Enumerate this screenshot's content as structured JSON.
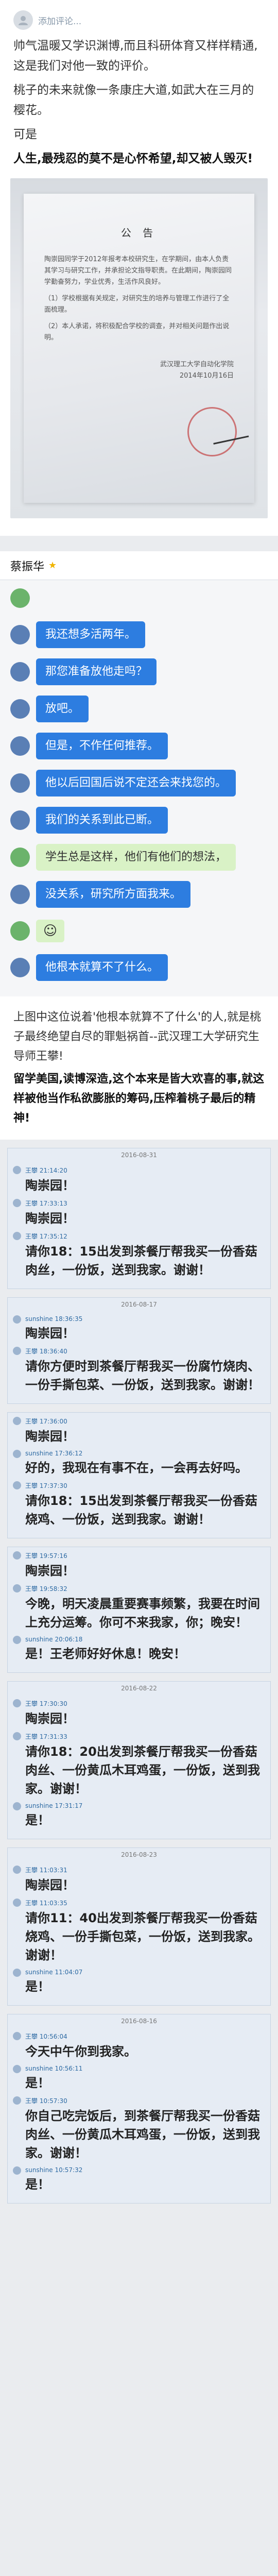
{
  "post": {
    "author_name": "添加评论...",
    "paragraphs": [
      "帅气温暖又学识渊博,而且科研体育又样样精通,这是我们对他一致的评价。",
      "桃子的未来就像一条康庄大道,如武大在三月的樱花。",
      "可是"
    ],
    "bold_paragraph": "人生,最残忍的莫不是心怀希望,却又被人毁灭!"
  },
  "notice": {
    "title": "公 告",
    "body": [
      "陶崇园同学于2012年报考本校研究生，在学期间，由本人负责其学习与研究工作，并承担论文指导职责。在此期间，陶崇园同学勤奋努力，学业优秀，生活作风良好。",
      "（1）学校根据有关规定，对研究生的培养与管理工作进行了全面梳理。",
      "（2）本人承诺，将积极配合学校的调查，并对相关问题作出说明。"
    ],
    "sign_lines": [
      "武汉理工大学自动化学院",
      "2014年10月16日"
    ]
  },
  "chat": {
    "contact_name": "蔡振华",
    "messages": [
      {
        "side": "green",
        "text": ""
      },
      {
        "side": "blue",
        "text": "我还想多活两年。"
      },
      {
        "side": "blue",
        "text": "那您准备放他走吗？"
      },
      {
        "side": "blue",
        "text": "放吧。"
      },
      {
        "side": "blue",
        "text": "但是，不作任何推荐。"
      },
      {
        "side": "blue",
        "text": "他以后回国后说不定还会来找您的。"
      },
      {
        "side": "blue",
        "text": "我们的关系到此已断。"
      },
      {
        "side": "green",
        "text": "学生总是这样，他们有他们的想法，"
      },
      {
        "side": "blue",
        "text": "没关系，研究所方面我来。"
      },
      {
        "side": "green",
        "text": "☺"
      },
      {
        "side": "blue",
        "text": "他根本就算不了什么。"
      }
    ]
  },
  "caption": {
    "line1": "上图中这位说着'他根本就算不了什么'的人,就是桃子最终绝望自尽的罪魁祸首--武汉理工大学研究生导师王攀!",
    "line2": "留学美国,读博深造,这个本来是皆大欢喜的事,就这样被他当作私欲膨胀的筹码,压榨着桃子最后的精神!"
  },
  "shots": [
    {
      "date": "2016-08-31",
      "items": [
        {
          "meta": "王攀 21:14:20",
          "text": "陶崇园！"
        },
        {
          "meta": "王攀 17:33:13",
          "text": "陶崇园！"
        },
        {
          "meta": "王攀 17:35:12",
          "text": "请你18：15出发到茶餐厅帮我买一份香菇肉丝，一份饭，送到我家。谢谢！"
        }
      ]
    },
    {
      "date": "2016-08-17",
      "items": [
        {
          "meta": "sunshine 18:36:35",
          "text": "陶崇园！"
        },
        {
          "meta": "王攀 18:36:40",
          "text": "请你方便时到茶餐厅帮我买一份腐竹烧肉、一份手撕包菜、一份饭，送到我家。谢谢！"
        }
      ]
    },
    {
      "date": "",
      "items": [
        {
          "meta": "王攀 17:36:00",
          "text": "陶崇园！"
        },
        {
          "meta": "sunshine 17:36:12",
          "text": "好的，我现在有事不在，一会再去好吗。"
        },
        {
          "meta": "王攀 17:37:30",
          "text": "请你18：15出发到茶餐厅帮我买一份香菇烧鸡、一份饭，送到我家。谢谢！"
        }
      ]
    },
    {
      "date": "",
      "items": [
        {
          "meta": "王攀 19:57:16",
          "text": "陶崇园！"
        },
        {
          "meta": "王攀 19:58:32",
          "text": "今晚，明天凌晨重要赛事频繁，我要在时间上充分运筹。你可不来我家，你；晚安！"
        },
        {
          "meta": "sunshine 20:06:18",
          "text": "是！王老师好好休息！晚安！"
        }
      ]
    },
    {
      "date": "2016-08-22",
      "items": [
        {
          "meta": "王攀 17:30:30",
          "text": "陶崇园！"
        },
        {
          "meta": "王攀 17:31:33",
          "text": "请你18：20出发到茶餐厅帮我买一份香菇肉丝、一份黄瓜木耳鸡蛋，一份饭，送到我家。谢谢！"
        },
        {
          "meta": "sunshine 17:31:17",
          "text": "是！"
        }
      ]
    },
    {
      "date": "2016-08-23",
      "items": [
        {
          "meta": "王攀 11:03:31",
          "text": "陶崇园！"
        },
        {
          "meta": "王攀 11:03:35",
          "text": "请你11：40出发到茶餐厅帮我买一份香菇烧鸡、一份手撕包菜，一份饭，送到我家。谢谢！"
        },
        {
          "meta": "sunshine 11:04:07",
          "text": "是！"
        }
      ]
    },
    {
      "date": "2016-08-16",
      "items": [
        {
          "meta": "王攀 10:56:04",
          "text": "今天中午你到我家。"
        },
        {
          "meta": "sunshine 10:56:11",
          "text": "是！"
        },
        {
          "meta": "王攀 10:57:30",
          "text": "你自己吃完饭后，到茶餐厅帮我买一份香菇肉丝、一份黄瓜木耳鸡蛋，一份饭，送到我家。谢谢！"
        },
        {
          "meta": "sunshine 10:57:32",
          "text": "是！"
        }
      ]
    }
  ]
}
